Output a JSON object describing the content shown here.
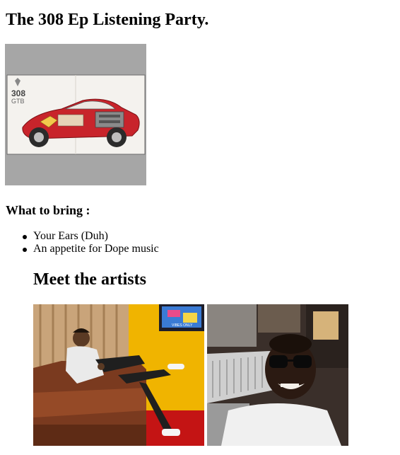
{
  "page": {
    "title": "The 308 Ep Listening Party.",
    "poster": {
      "badge_line1": "308",
      "badge_line2": "GTB"
    },
    "bring": {
      "heading": "What to bring :",
      "items": [
        "Your Ears (Duh)",
        "An appetite for Dope music"
      ]
    },
    "artists": {
      "heading": "Meet the artists",
      "tv_caption": "VIBES ONLY"
    }
  },
  "colors": {
    "poster_bg": "#a6a6a6",
    "car_red": "#c8242b",
    "wall_yellow": "#f0b400",
    "sofa_brown": "#7a3a1f",
    "studio_dark": "#3a2f2a"
  }
}
